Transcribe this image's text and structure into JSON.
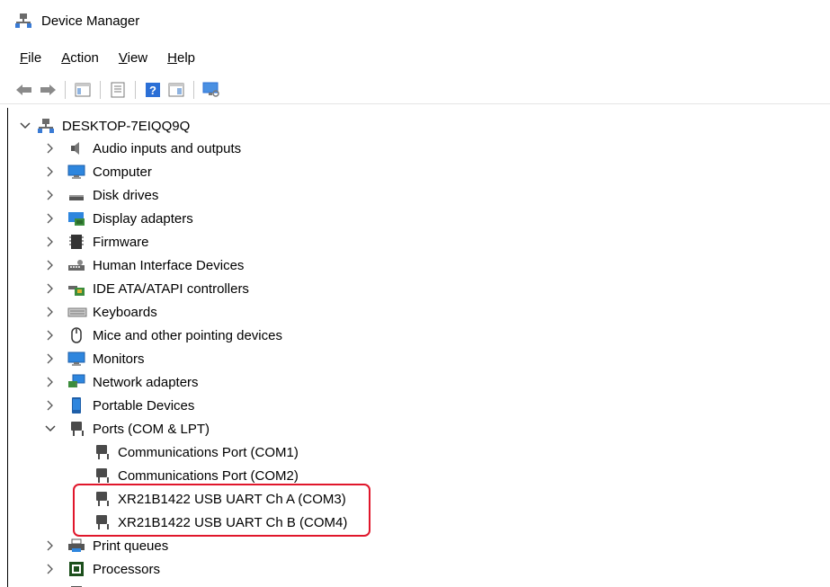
{
  "window": {
    "title": "Device Manager"
  },
  "menu": [
    {
      "accel": "F",
      "rest": "ile"
    },
    {
      "accel": "A",
      "rest": "ction"
    },
    {
      "accel": "V",
      "rest": "iew"
    },
    {
      "accel": "H",
      "rest": "elp"
    }
  ],
  "toolbar": {
    "icons": [
      "back-icon",
      "forward-icon",
      "show-hide-console-tree-icon",
      "properties-icon",
      "help-icon",
      "update-driver-icon",
      "scan-hardware-icon"
    ]
  },
  "tree": {
    "root": "DESKTOP-7EIQQ9Q",
    "categories": [
      {
        "label": "Audio inputs and outputs",
        "icon": "speaker-icon"
      },
      {
        "label": "Computer",
        "icon": "monitor-icon"
      },
      {
        "label": "Disk drives",
        "icon": "disk-drive-icon"
      },
      {
        "label": "Display adapters",
        "icon": "display-adapter-icon"
      },
      {
        "label": "Firmware",
        "icon": "firmware-icon"
      },
      {
        "label": "Human Interface Devices",
        "icon": "hid-icon"
      },
      {
        "label": "IDE ATA/ATAPI controllers",
        "icon": "ide-controller-icon"
      },
      {
        "label": "Keyboards",
        "icon": "keyboard-icon"
      },
      {
        "label": "Mice and other pointing devices",
        "icon": "mouse-icon"
      },
      {
        "label": "Monitors",
        "icon": "monitor-icon"
      },
      {
        "label": "Network adapters",
        "icon": "network-adapter-icon"
      },
      {
        "label": "Portable Devices",
        "icon": "portable-device-icon"
      },
      {
        "label": "Ports (COM & LPT)",
        "icon": "port-icon"
      }
    ],
    "ports_children": [
      "Communications Port (COM1)",
      "Communications Port (COM2)",
      "XR21B1422 USB UART Ch A (COM3)",
      "XR21B1422 USB UART Ch B (COM4)"
    ],
    "after_ports": [
      {
        "label": "Print queues",
        "icon": "printer-icon"
      },
      {
        "label": "Processors",
        "icon": "processor-icon"
      }
    ]
  },
  "colors": {
    "highlight": "#e0162b",
    "accent_blue": "#2b6fd6"
  }
}
